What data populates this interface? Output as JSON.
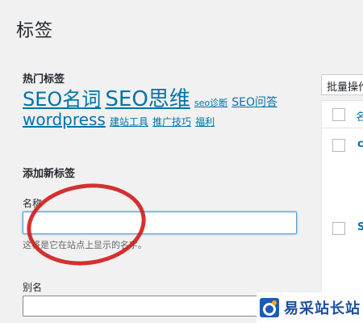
{
  "page": {
    "title": "标签"
  },
  "popular": {
    "heading": "热门标签",
    "tags": [
      "SEO名词",
      "SEO思维",
      "seo诊断",
      "SEO问答",
      "wordpress",
      "建站工具",
      "推广技巧",
      "福利"
    ]
  },
  "add_form": {
    "heading": "添加新标签",
    "name_label": "名称",
    "name_value": "",
    "name_hint": "这将是它在站点上显示的名字。",
    "slug_label": "别名",
    "slug_value": ""
  },
  "list": {
    "bulk_action": "批量操作",
    "column_name": "名",
    "row1_text": "c",
    "row2_text": "S"
  },
  "watermark": {
    "text": "易采站长站"
  },
  "colors": {
    "link": "#0073aa",
    "annotation": "#d21a1a",
    "background": "#f1f1f1"
  }
}
